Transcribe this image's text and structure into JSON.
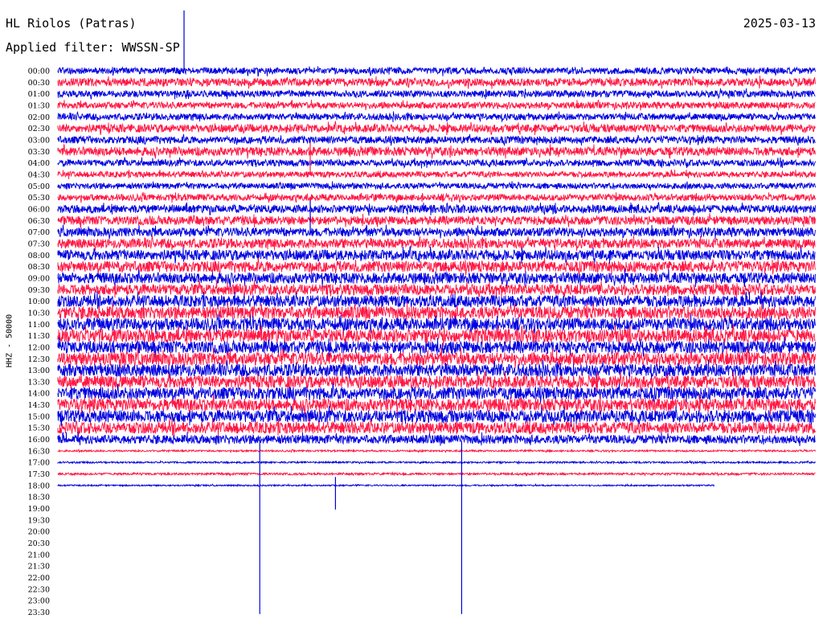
{
  "header": {
    "station": "HL Riolos (Patras)",
    "filter": "Applied filter: WWSSN-SP",
    "date": "2025-03-13"
  },
  "axis": {
    "ylabel": "HHZ - 50000"
  },
  "chart_data": {
    "type": "line",
    "title": "HL Riolos (Patras)",
    "subtitle": "Applied filter: WWSSN-SP",
    "ylabel": "HHZ - 50000",
    "date": "2025-03-13",
    "row_labels": [
      "00:00",
      "00:30",
      "01:00",
      "01:30",
      "02:00",
      "02:30",
      "03:00",
      "03:30",
      "04:00",
      "04:30",
      "05:00",
      "05:30",
      "06:00",
      "06:30",
      "07:00",
      "07:30",
      "08:00",
      "08:30",
      "09:00",
      "09:30",
      "10:00",
      "10:30",
      "11:00",
      "11:30",
      "12:00",
      "12:30",
      "13:00",
      "13:30",
      "14:00",
      "14:30",
      "15:00",
      "15:30",
      "16:00",
      "16:30",
      "17:00",
      "17:30",
      "18:00",
      "18:30",
      "19:00",
      "19:30",
      "20:00",
      "20:30",
      "21:00",
      "21:30",
      "22:00",
      "22:30",
      "23:00",
      "23:30"
    ],
    "row_minutes": 30,
    "series_colors": [
      "#0000e0",
      "#ff1744"
    ],
    "recorded_until": "18:26",
    "trace_amplitude": [
      0.45,
      0.55,
      0.45,
      0.45,
      0.45,
      0.55,
      0.5,
      0.6,
      0.45,
      0.4,
      0.4,
      0.45,
      0.55,
      0.6,
      0.6,
      0.65,
      0.7,
      0.75,
      0.75,
      0.75,
      0.8,
      0.85,
      0.85,
      0.9,
      0.85,
      0.9,
      0.85,
      0.85,
      0.85,
      0.85,
      0.85,
      0.8,
      0.6,
      0.12,
      0.12,
      0.15,
      0.1,
      0,
      0,
      0,
      0,
      0,
      0,
      0,
      0,
      0,
      0,
      0
    ],
    "events": [
      {
        "time": "00:05",
        "note": "spike"
      },
      {
        "time": "03:40",
        "note": "burst"
      },
      {
        "time": "06:10",
        "note": "burst"
      },
      {
        "time": "18:08",
        "note": "spike"
      },
      {
        "time": "18:11",
        "note": "event"
      },
      {
        "time": "18:16",
        "note": "spike"
      }
    ]
  }
}
